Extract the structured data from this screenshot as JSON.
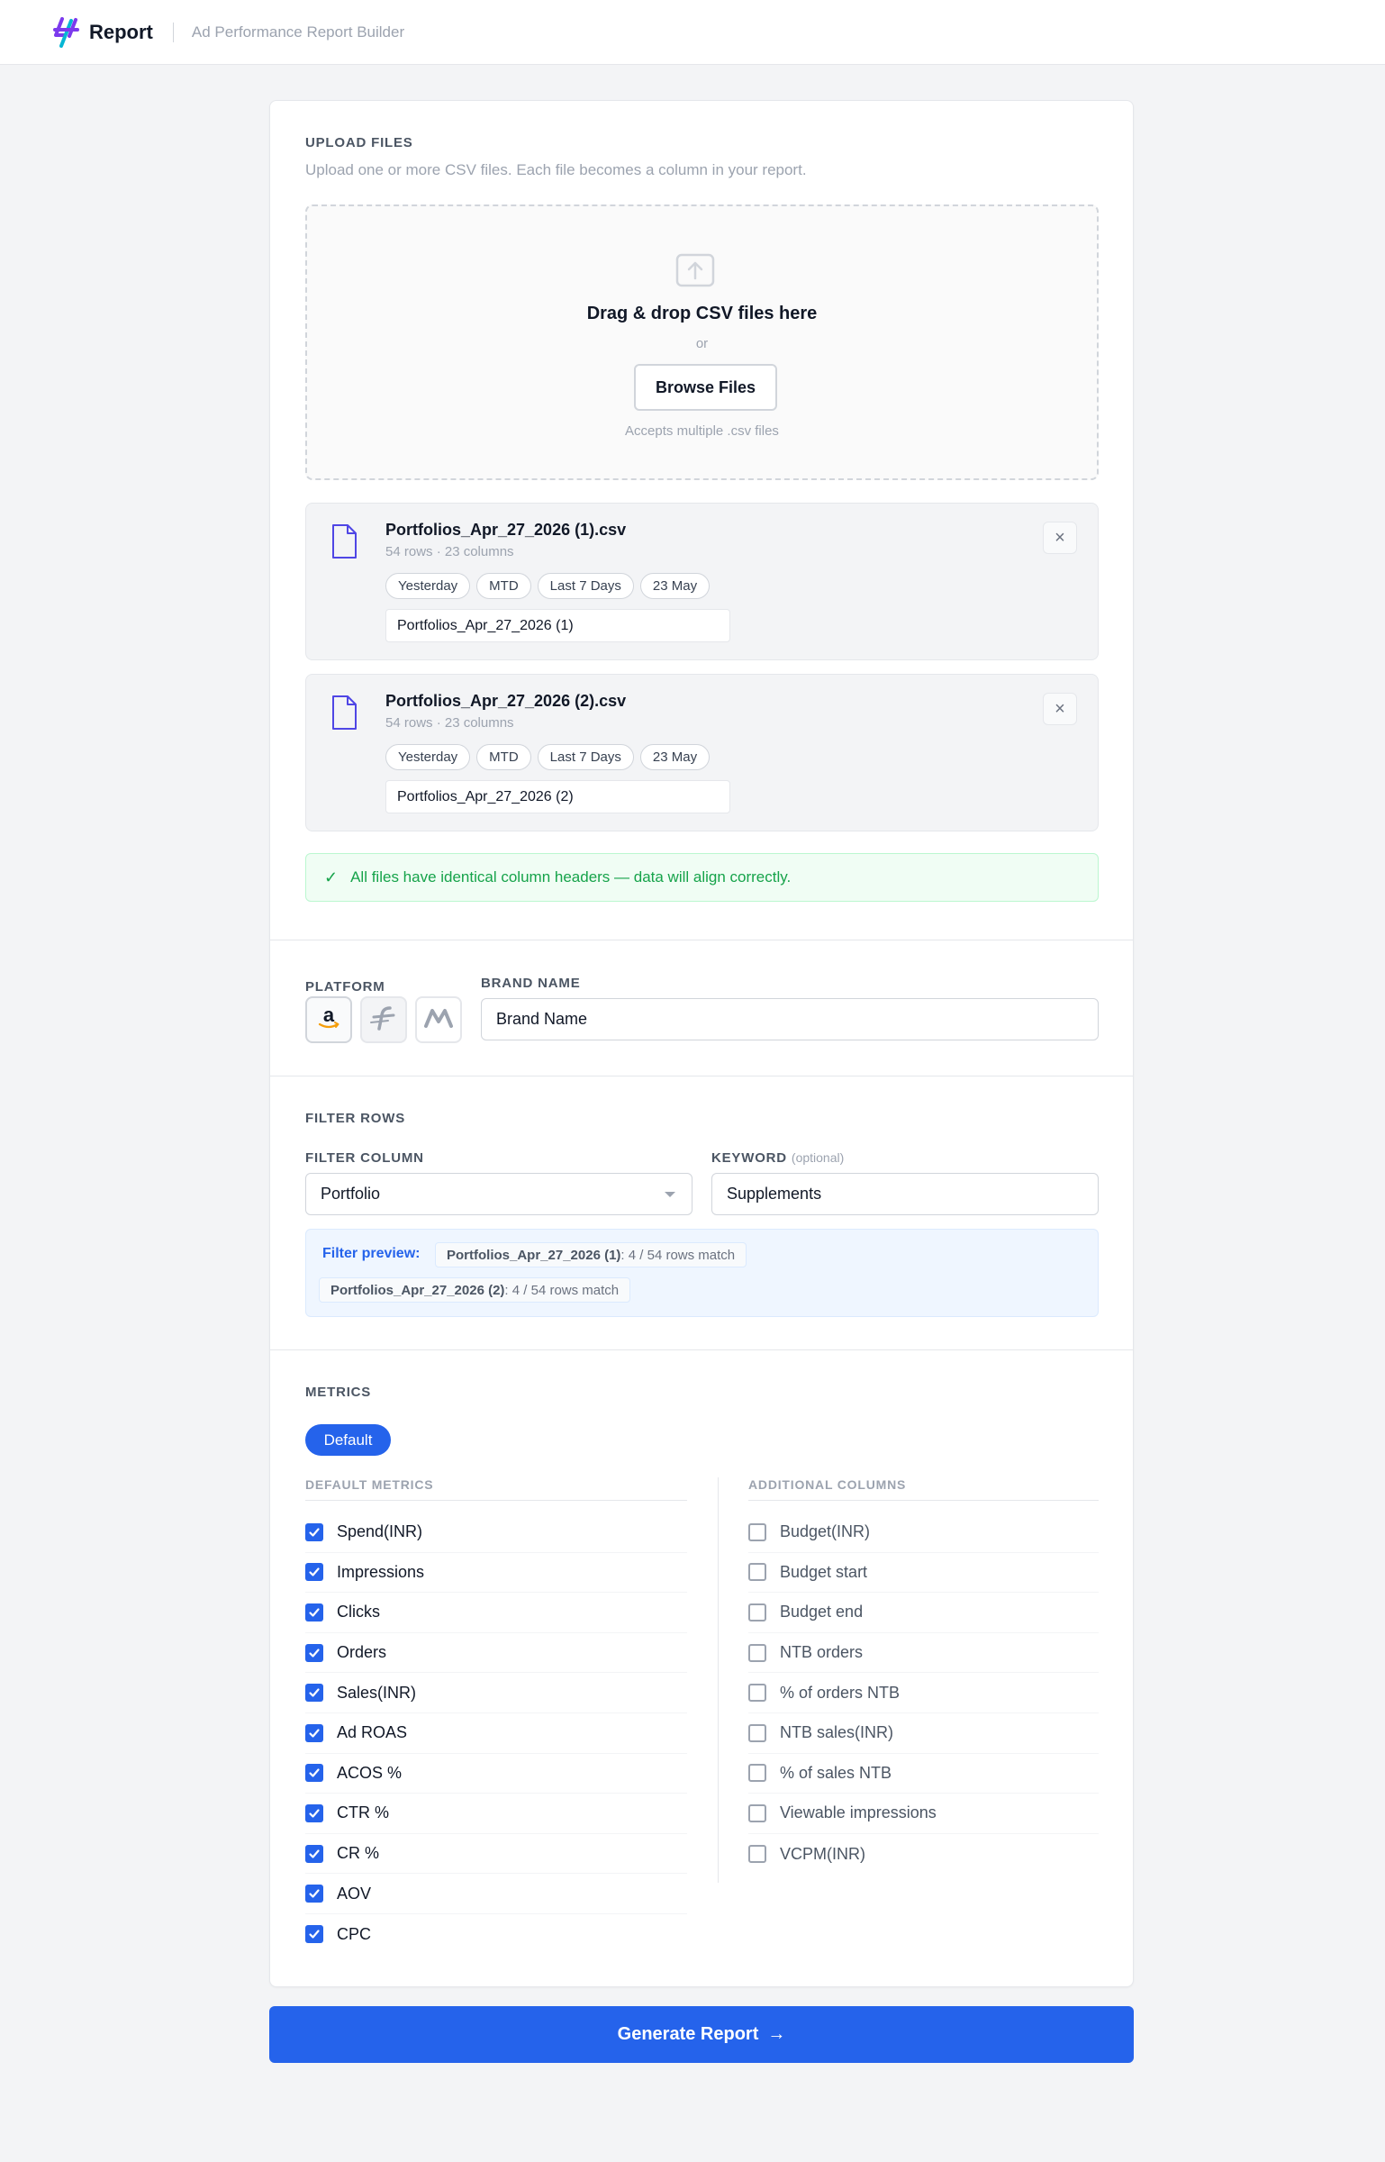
{
  "header": {
    "app_title": "Report",
    "app_subtitle": "Ad Performance Report Builder"
  },
  "upload": {
    "section_label": "UPLOAD FILES",
    "description": "Upload one or more CSV files. Each file becomes a column in your report.",
    "dropzone_title": "Drag & drop CSV files here",
    "dropzone_or": "or",
    "browse_label": "Browse Files",
    "accepts_text": "Accepts multiple .csv files",
    "files": [
      {
        "name": "Portfolios_Apr_27_2026 (1).csv",
        "meta": "54 rows · 23 columns",
        "tags": [
          "Yesterday",
          "MTD",
          "Last 7 Days",
          "23 May"
        ],
        "label_value": "Portfolios_Apr_27_2026 (1)"
      },
      {
        "name": "Portfolios_Apr_27_2026 (2).csv",
        "meta": "54 rows · 23 columns",
        "tags": [
          "Yesterday",
          "MTD",
          "Last 7 Days",
          "23 May"
        ],
        "label_value": "Portfolios_Apr_27_2026 (2)"
      }
    ],
    "success_message": "All files have identical column headers — data will align correctly."
  },
  "platform": {
    "label": "PLATFORM",
    "options": [
      "amazon-logo-icon",
      "flipkart-logo-icon",
      "myntra-logo-icon"
    ],
    "selected": "amazon-logo-icon"
  },
  "brand": {
    "label": "BRAND NAME",
    "value": "Brand Name"
  },
  "filter": {
    "section_label": "FILTER ROWS",
    "column_label": "FILTER COLUMN",
    "column_value": "Portfolio",
    "keyword_label": "KEYWORD",
    "keyword_optional": "(optional)",
    "keyword_value": "Supplements",
    "preview_label": "Filter preview:",
    "preview_items": [
      {
        "file": "Portfolios_Apr_27_2026 (1)",
        "result": ": 4 / 54 rows match"
      },
      {
        "file": "Portfolios_Apr_27_2026 (2)",
        "result": ": 4 / 54 rows match"
      }
    ]
  },
  "metrics": {
    "section_label": "METRICS",
    "preset_label": "Default",
    "default_heading": "DEFAULT METRICS",
    "additional_heading": "ADDITIONAL COLUMNS",
    "default_items": [
      {
        "label": "Spend(INR)",
        "checked": true
      },
      {
        "label": "Impressions",
        "checked": true
      },
      {
        "label": "Clicks",
        "checked": true
      },
      {
        "label": "Orders",
        "checked": true
      },
      {
        "label": "Sales(INR)",
        "checked": true
      },
      {
        "label": "Ad ROAS",
        "checked": true
      },
      {
        "label": "ACOS %",
        "checked": true
      },
      {
        "label": "CTR %",
        "checked": true
      },
      {
        "label": "CR %",
        "checked": true
      },
      {
        "label": "AOV",
        "checked": true
      },
      {
        "label": "CPC",
        "checked": true
      }
    ],
    "additional_items": [
      {
        "label": "Budget(INR)",
        "checked": false
      },
      {
        "label": "Budget start",
        "checked": false
      },
      {
        "label": "Budget end",
        "checked": false
      },
      {
        "label": "NTB orders",
        "checked": false
      },
      {
        "label": "% of orders NTB",
        "checked": false
      },
      {
        "label": "NTB sales(INR)",
        "checked": false
      },
      {
        "label": "% of sales NTB",
        "checked": false
      },
      {
        "label": "Viewable impressions",
        "checked": false
      },
      {
        "label": "VCPM(INR)",
        "checked": false
      }
    ]
  },
  "actions": {
    "generate_label": "Generate Report",
    "generate_arrow": "→"
  },
  "colors": {
    "accent": "#2563eb",
    "success": "#16a34a",
    "logo_purple": "#7c3aed",
    "logo_teal": "#06b6d4"
  }
}
